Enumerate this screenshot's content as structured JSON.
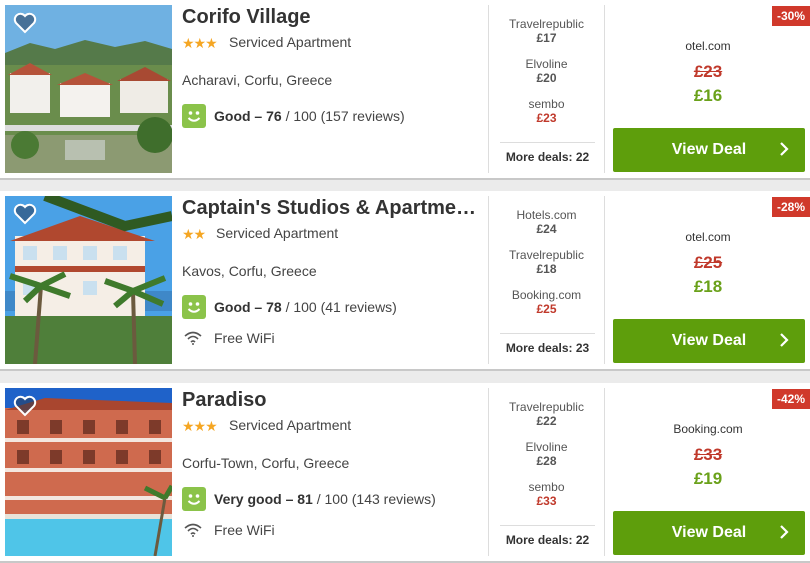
{
  "hotels": [
    {
      "name": "Corifo Village",
      "stars": "★★★",
      "type": "Serviced Apartment",
      "location": "Acharavi, Corfu, Greece",
      "rating_word": "Good – 76",
      "rating_rest": " / 100 (157 reviews)",
      "wifi": "",
      "providers": [
        {
          "name": "Travelrepublic",
          "price": "£17",
          "highlight": false
        },
        {
          "name": "Elvoline",
          "price": "£20",
          "highlight": false
        },
        {
          "name": "sembo",
          "price": "£23",
          "highlight": true
        }
      ],
      "more_deals": "More deals: 22",
      "discount": "-30%",
      "deal_provider": "otel.com",
      "old_price": "£23",
      "new_price": "£16",
      "button": "View Deal"
    },
    {
      "name": "Captain's Studios & Apartme…",
      "stars": "★★",
      "type": "Serviced Apartment",
      "location": "Kavos, Corfu, Greece",
      "rating_word": "Good – 78",
      "rating_rest": " / 100 (41 reviews)",
      "wifi": "Free WiFi",
      "providers": [
        {
          "name": "Hotels.com",
          "price": "£24",
          "highlight": false
        },
        {
          "name": "Travelrepublic",
          "price": "£18",
          "highlight": false
        },
        {
          "name": "Booking.com",
          "price": "£25",
          "highlight": true
        }
      ],
      "more_deals": "More deals: 23",
      "discount": "-28%",
      "deal_provider": "otel.com",
      "old_price": "£25",
      "new_price": "£18",
      "button": "View Deal"
    },
    {
      "name": "Paradiso",
      "stars": "★★★",
      "type": "Serviced Apartment",
      "location": "Corfu-Town, Corfu, Greece",
      "rating_word": "Very good – 81",
      "rating_rest": " / 100 (143 reviews)",
      "wifi": "Free WiFi",
      "providers": [
        {
          "name": "Travelrepublic",
          "price": "£22",
          "highlight": false
        },
        {
          "name": "Elvoline",
          "price": "£28",
          "highlight": false
        },
        {
          "name": "sembo",
          "price": "£33",
          "highlight": true
        }
      ],
      "more_deals": "More deals: 22",
      "discount": "-42%",
      "deal_provider": "Booking.com",
      "old_price": "£33",
      "new_price": "£19",
      "button": "View Deal"
    }
  ],
  "colors": {
    "deal_button": "#5e9e0c",
    "discount_badge": "#d0392b",
    "new_price": "#6aa11a",
    "old_price": "#c0392b",
    "rating_icon": "#8bc34a",
    "stars": "#f5a623"
  },
  "icons": [
    "heart-icon",
    "smiley-rating-icon",
    "wifi-icon",
    "chevron-right-icon"
  ]
}
